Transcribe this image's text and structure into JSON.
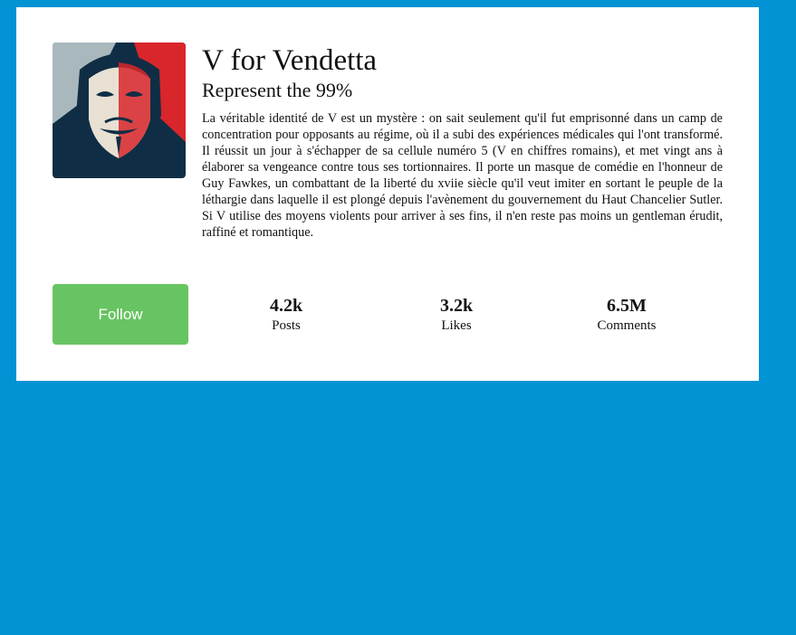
{
  "profile": {
    "name": "V for Vendetta",
    "tagline": "Represent the 99%",
    "bio": "La véritable identité de V est un mystère : on sait seulement qu'il fut emprisonné dans un camp de concentration pour opposants au régime, où il a subi des expériences médicales qui l'ont transformé. Il réussit un jour à s'échapper de sa cellule numéro 5 (V en chiffres romains), et met vingt ans à élaborer sa vengeance contre tous ses tortionnaires. Il porte un masque de comédie en l'honneur de Guy Fawkes, un combattant de la liberté du xviie siècle qu'il veut imiter en sortant le peuple de la léthargie dans laquelle il est plongé depuis l'avènement du gouvernement du Haut Chancelier Sutler. Si V utilise des moyens violents pour arriver à ses fins, il n'en reste pas moins un gentleman érudit, raffiné et romantique.",
    "avatar_icon": "guy-fawkes-mask-portrait"
  },
  "actions": {
    "follow_label": "Follow"
  },
  "stats": [
    {
      "value": "4.2k",
      "label": "Posts"
    },
    {
      "value": "3.2k",
      "label": "Likes"
    },
    {
      "value": "6.5M",
      "label": "Comments"
    }
  ],
  "colors": {
    "background": "#0293d5",
    "card": "#ffffff",
    "follow_button": "#67c462"
  }
}
